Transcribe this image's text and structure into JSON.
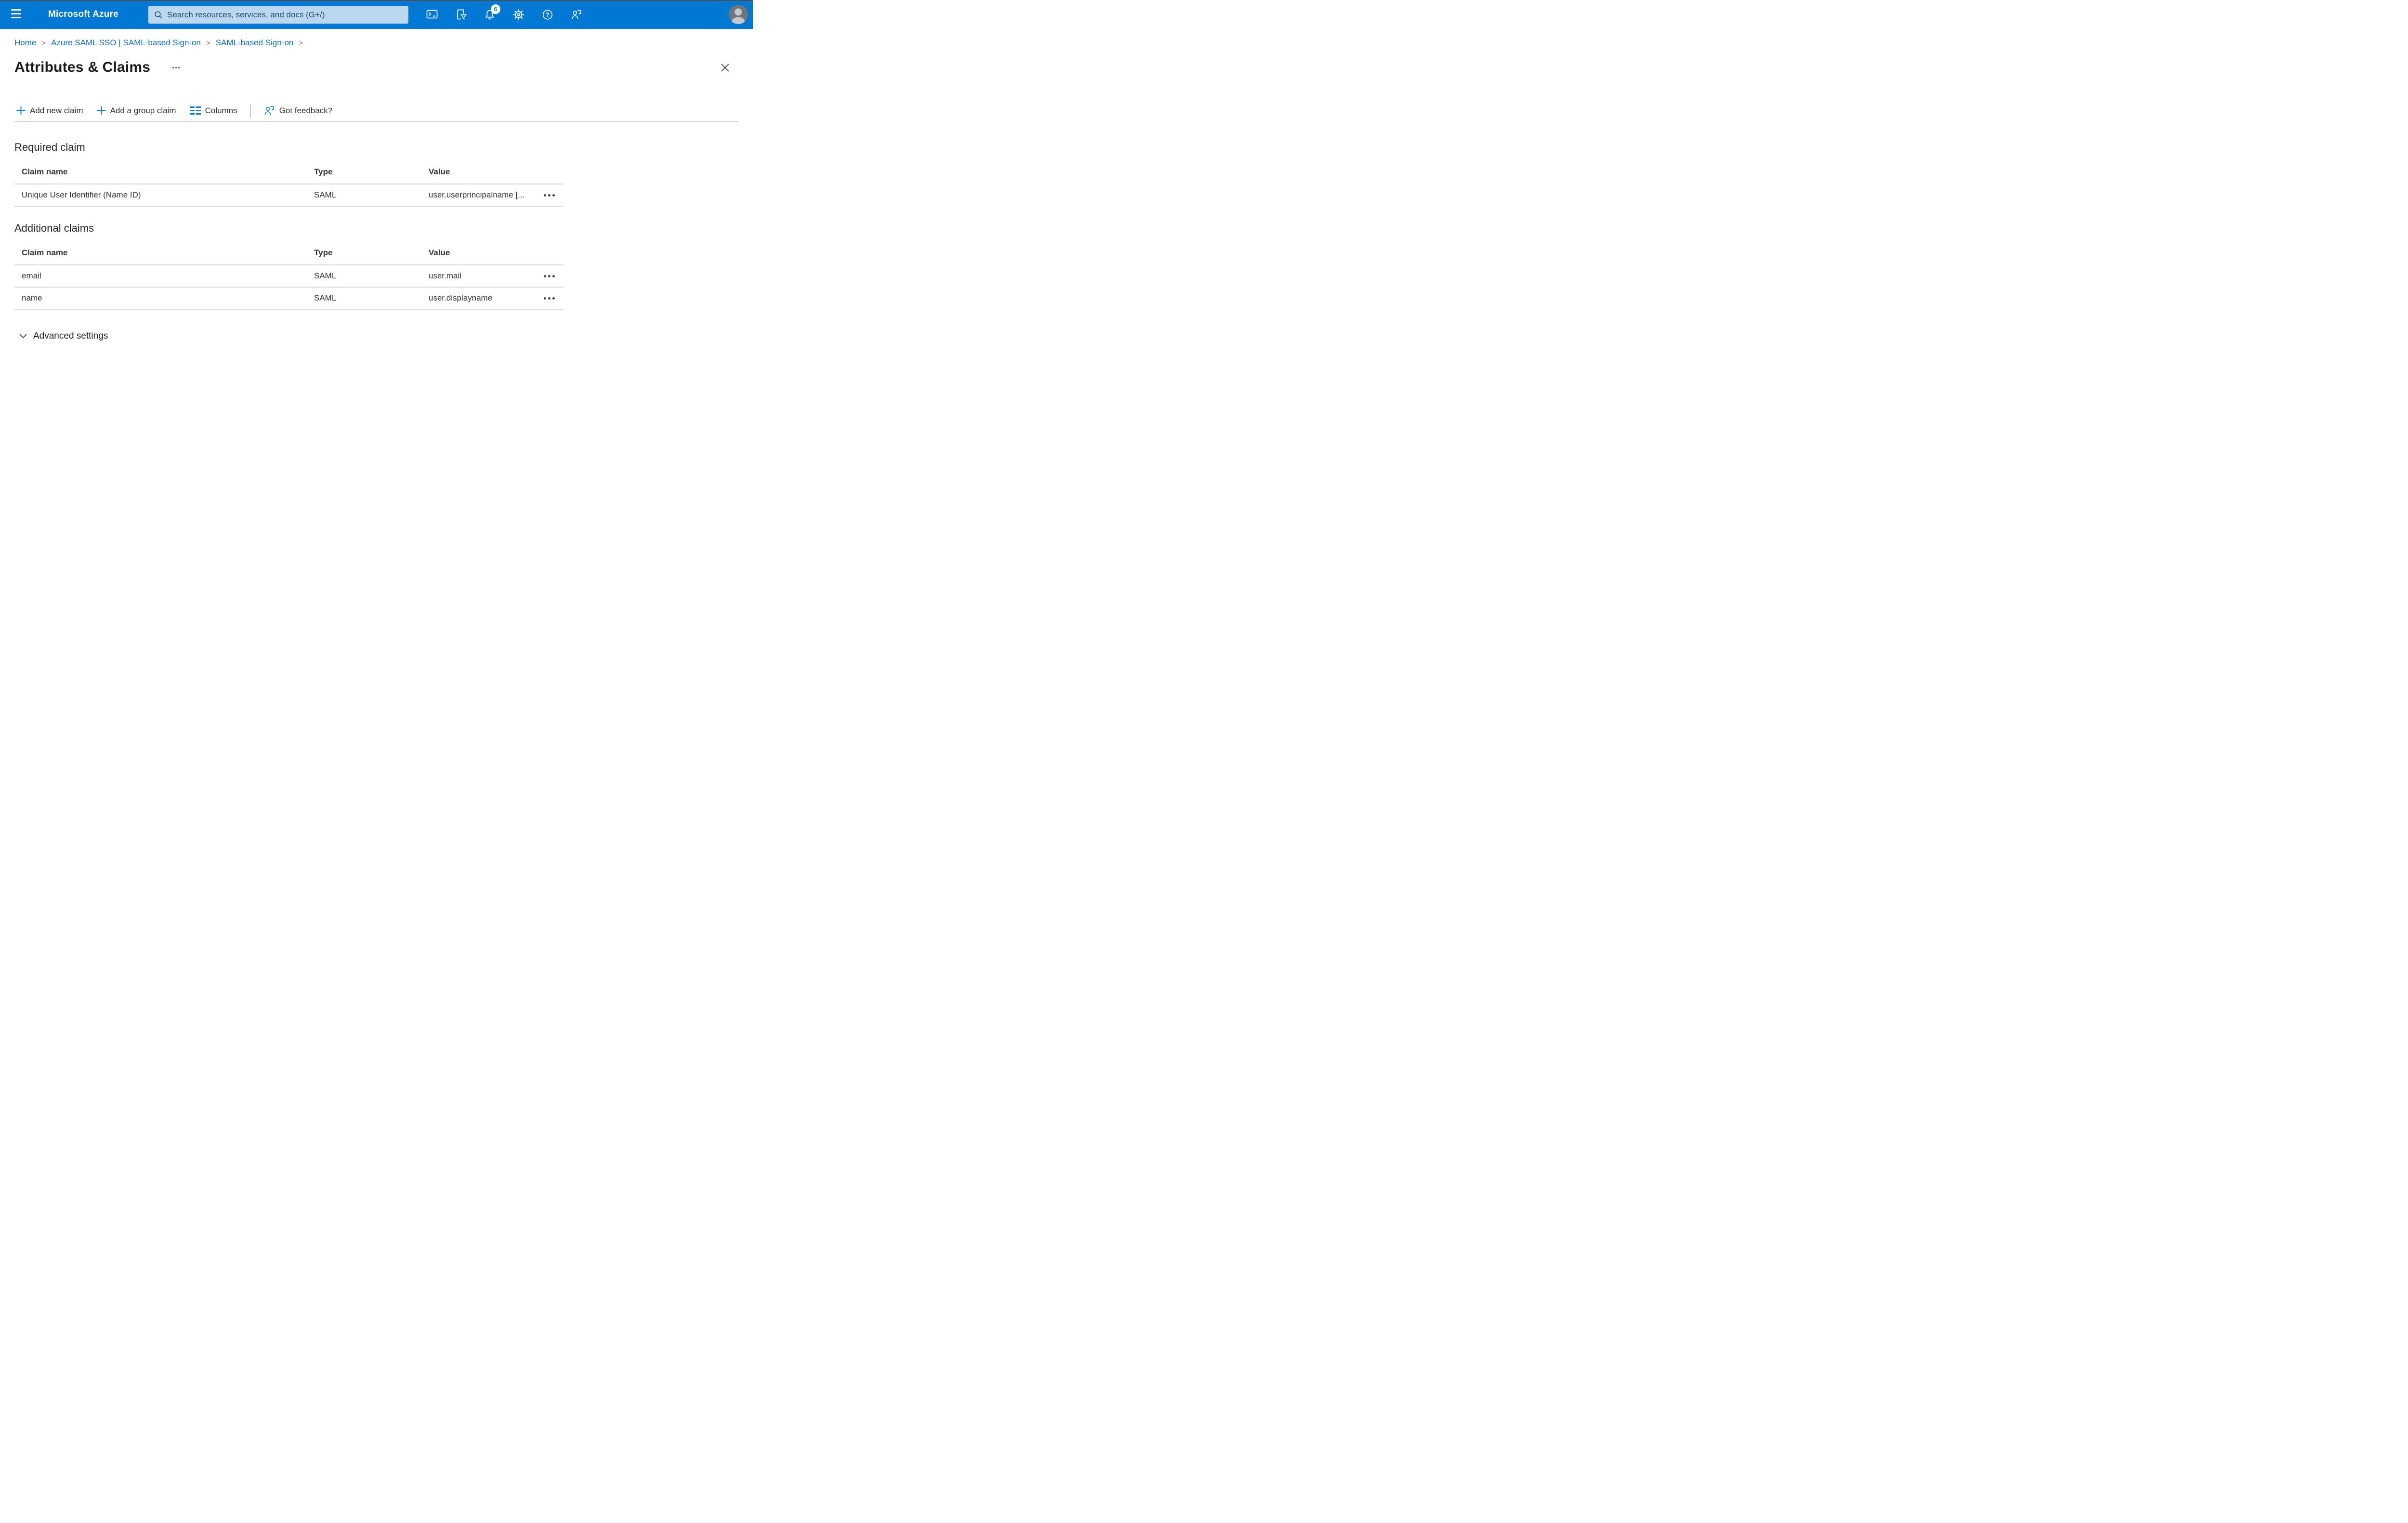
{
  "topbar": {
    "title": "Microsoft Azure",
    "search": {
      "placeholder": "Search resources, services, and docs (G+/)"
    },
    "notifications_badge": "6"
  },
  "breadcrumb": {
    "separator": ">",
    "items": [
      {
        "label": "Home"
      },
      {
        "label": "Azure SAML SSO | SAML-based Sign-on"
      },
      {
        "label": "SAML-based Sign-on"
      }
    ]
  },
  "page": {
    "title": "Attributes & Claims"
  },
  "toolbar": {
    "add_new_claim": "Add new claim",
    "add_group_claim": "Add a group claim",
    "columns": "Columns",
    "got_feedback": "Got feedback?"
  },
  "sections": {
    "required": {
      "heading": "Required claim",
      "columns": [
        "Claim name",
        "Type",
        "Value"
      ],
      "rows": [
        {
          "name": "Unique User Identifier (Name ID)",
          "type": "SAML",
          "value": "user.userprincipalname [..."
        }
      ]
    },
    "additional": {
      "heading": "Additional claims",
      "columns": [
        "Claim name",
        "Type",
        "Value"
      ],
      "rows": [
        {
          "name": "email",
          "type": "SAML",
          "value": "user.mail"
        },
        {
          "name": "name",
          "type": "SAML",
          "value": "user.displayname"
        }
      ]
    }
  },
  "advanced_settings": {
    "label": "Advanced settings"
  },
  "colors": {
    "header_bg": "#0078d4",
    "accent_blue": "#0a78d4",
    "link_blue": "#0c6dc2",
    "search_bg": "#bcd8f1",
    "search_text": "#1f4b68",
    "divider": "#d8d8d8",
    "text": "#2b2b2b"
  }
}
